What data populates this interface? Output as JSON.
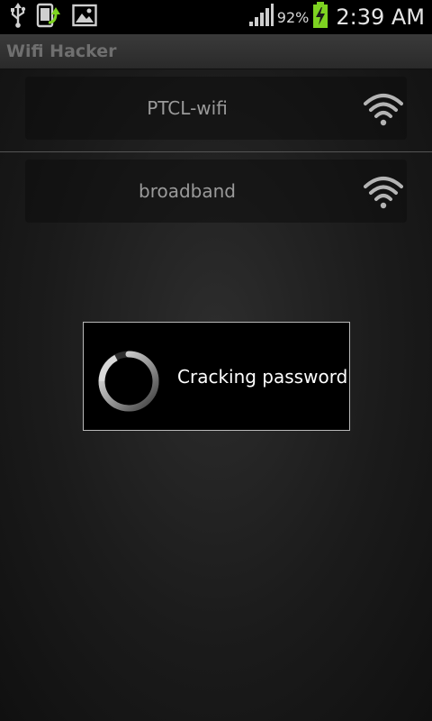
{
  "status_bar": {
    "icons_left": [
      "usb-icon",
      "sync-icon",
      "gallery-icon"
    ],
    "signal_icon": "signal-bars-icon",
    "battery_percent": "92%",
    "battery_icon": "battery-charging-icon",
    "time": "2:39 AM"
  },
  "app": {
    "title": "Wifi Hacker"
  },
  "networks": [
    {
      "ssid": "PTCL-wifi",
      "icon": "wifi-signal-icon"
    },
    {
      "ssid": "broadband",
      "icon": "wifi-signal-icon"
    }
  ],
  "dialog": {
    "message": "Cracking password",
    "icon": "spinner-icon"
  },
  "colors": {
    "battery_green": "#7ed321",
    "dialog_border": "#b9b9b9",
    "ssid_text": "#9a9a9a"
  }
}
